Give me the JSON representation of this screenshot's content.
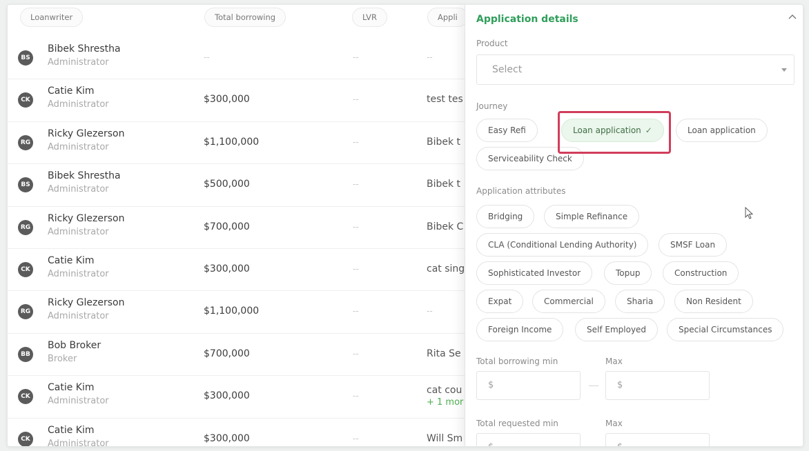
{
  "table": {
    "headers": [
      "Loanwriter",
      "Total borrowing",
      "LVR",
      "Appli"
    ],
    "rows": [
      {
        "initials": "BS",
        "name": "Bibek Shrestha",
        "role": "Administrator",
        "borrowing": "--",
        "lvr": "--",
        "application": "--",
        "more": ""
      },
      {
        "initials": "CK",
        "name": "Catie Kim",
        "role": "Administrator",
        "borrowing": "$300,000",
        "lvr": "--",
        "application": "test tes",
        "more": ""
      },
      {
        "initials": "RG",
        "name": "Ricky Glezerson",
        "role": "Administrator",
        "borrowing": "$1,100,000",
        "lvr": "--",
        "application": "Bibek t",
        "more": ""
      },
      {
        "initials": "BS",
        "name": "Bibek Shrestha",
        "role": "Administrator",
        "borrowing": "$500,000",
        "lvr": "--",
        "application": "Bibek t",
        "more": ""
      },
      {
        "initials": "RG",
        "name": "Ricky Glezerson",
        "role": "Administrator",
        "borrowing": "$700,000",
        "lvr": "--",
        "application": "Bibek C",
        "more": ""
      },
      {
        "initials": "CK",
        "name": "Catie Kim",
        "role": "Administrator",
        "borrowing": "$300,000",
        "lvr": "--",
        "application": "cat sing",
        "more": ""
      },
      {
        "initials": "RG",
        "name": "Ricky Glezerson",
        "role": "Administrator",
        "borrowing": "$1,100,000",
        "lvr": "--",
        "application": "--",
        "more": ""
      },
      {
        "initials": "BB",
        "name": "Bob Broker",
        "role": "Broker",
        "borrowing": "$700,000",
        "lvr": "--",
        "application": "Rita Se",
        "more": ""
      },
      {
        "initials": "CK",
        "name": "Catie Kim",
        "role": "Administrator",
        "borrowing": "$300,000",
        "lvr": "--",
        "application": "cat cou",
        "more": "+ 1 more"
      },
      {
        "initials": "CK",
        "name": "Catie Kim",
        "role": "Administrator",
        "borrowing": "$300,000",
        "lvr": "--",
        "application": "Will Sm",
        "more": ""
      }
    ]
  },
  "panel": {
    "title": "Application details",
    "product": {
      "label": "Product",
      "placeholder": "Select"
    },
    "journey": {
      "label": "Journey",
      "chips": [
        {
          "label": "Easy Refi",
          "active": false
        },
        {
          "label": "Loan application",
          "active": true
        },
        {
          "label": "Loan application",
          "active": false
        },
        {
          "label": "Serviceability Check",
          "active": false
        }
      ]
    },
    "attributes": {
      "label": "Application attributes",
      "chips": [
        "Bridging",
        "Simple Refinance",
        "CLA (Conditional Lending Authority)",
        "SMSF Loan",
        "Sophisticated Investor",
        "Topup",
        "Construction",
        "Expat",
        "Commercial",
        "Sharia",
        "Non Resident",
        "Foreign Income",
        "Self Employed",
        "Special Circumstances"
      ]
    },
    "total_borrowing": {
      "min_label": "Total borrowing min",
      "max_label": "Max",
      "min_value": "$",
      "max_value": "$"
    },
    "total_requested": {
      "min_label": "Total requested min",
      "max_label": "Max",
      "min_value": "$",
      "max_value": "$"
    }
  },
  "colors": {
    "accent": "#2f9e5a",
    "highlight": "#d13d5a",
    "active_chip": "#ebf6ec"
  }
}
